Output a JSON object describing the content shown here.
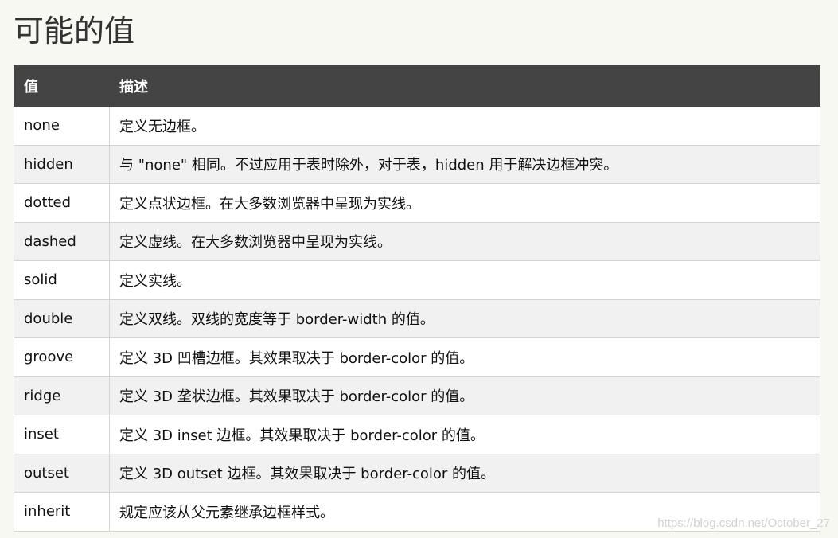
{
  "page": {
    "title": "可能的值",
    "watermark": "https://blog.csdn.net/October_27"
  },
  "table": {
    "headers": [
      "值",
      "描述"
    ],
    "rows": [
      {
        "value": "none",
        "description": "定义无边框。"
      },
      {
        "value": "hidden",
        "description": "与 \"none\" 相同。不过应用于表时除外，对于表，hidden 用于解决边框冲突。"
      },
      {
        "value": "dotted",
        "description": "定义点状边框。在大多数浏览器中呈现为实线。"
      },
      {
        "value": "dashed",
        "description": "定义虚线。在大多数浏览器中呈现为实线。"
      },
      {
        "value": "solid",
        "description": "定义实线。"
      },
      {
        "value": "double",
        "description": "定义双线。双线的宽度等于 border-width 的值。"
      },
      {
        "value": "groove",
        "description": "定义 3D 凹槽边框。其效果取决于 border-color 的值。"
      },
      {
        "value": "ridge",
        "description": "定义 3D 垄状边框。其效果取决于 border-color 的值。"
      },
      {
        "value": "inset",
        "description": "定义 3D inset 边框。其效果取决于 border-color 的值。"
      },
      {
        "value": "outset",
        "description": "定义 3D outset 边框。其效果取决于 border-color 的值。"
      },
      {
        "value": "inherit",
        "description": "规定应该从父元素继承边框样式。"
      }
    ]
  },
  "colors": {
    "header_bg": "#444444",
    "header_text": "#ffffff",
    "row_odd": "#ffffff",
    "row_even": "#f1f1f1",
    "border": "#d4d4d4",
    "page_bg": "#f8f8f3"
  }
}
